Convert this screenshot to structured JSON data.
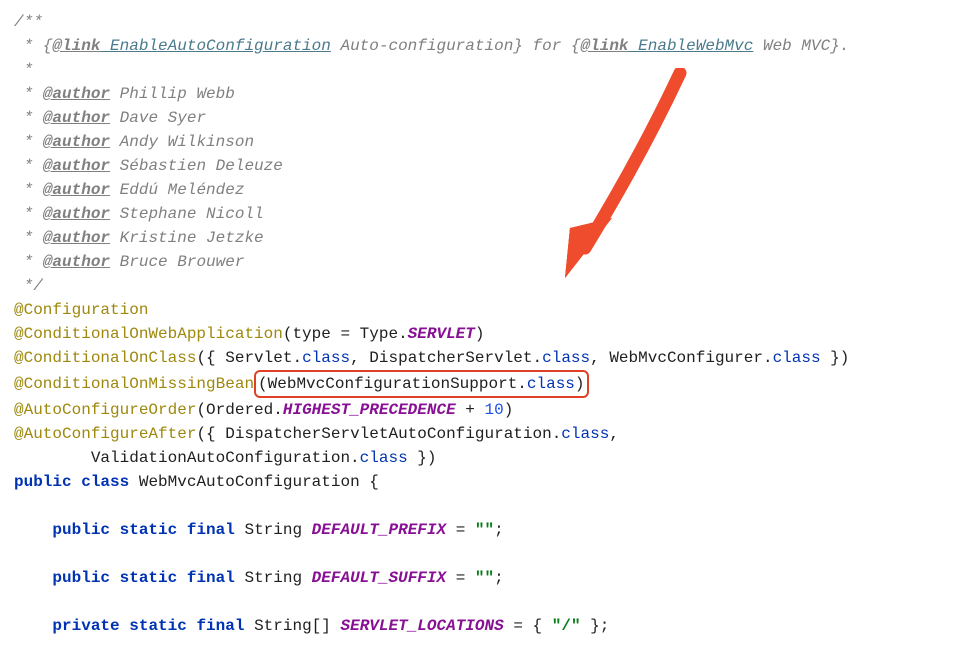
{
  "javadoc": {
    "open": "/**",
    "star": " *",
    "desc_prefix": " * {",
    "desc_link1_tag": "@link",
    "desc_link1_target": " EnableAutoConfiguration",
    "desc_link1_label": " Auto-configuration",
    "desc_mid": "} for {",
    "desc_link2_tag": "@link",
    "desc_link2_target": " EnableWebMvc",
    "desc_link2_label": " Web MVC",
    "desc_end": "}.",
    "author_tag": "@author",
    "authors": [
      " Phillip Webb",
      " Dave Syer",
      " Andy Wilkinson",
      " Sébastien Deleuze",
      " Eddú Meléndez",
      " Stephane Nicoll",
      " Kristine Jetzke",
      " Bruce Brouwer"
    ],
    "close": " */"
  },
  "annotations": {
    "a1": "@Configuration",
    "a2_name": "@ConditionalOnWebApplication",
    "a2_open": "(type = Type.",
    "a2_field": "SERVLET",
    "a2_close": ")",
    "a3_name": "@ConditionalOnClass",
    "a3_open": "({ Servlet.",
    "a3_k1": "class",
    "a3_c1": ", DispatcherServlet.",
    "a3_k2": "class",
    "a3_c2": ", WebMvcConfigurer.",
    "a3_k3": "class",
    "a3_end": " })",
    "a4_name": "@ConditionalOnMissingBean",
    "a4_boxed_open": "(WebMvcConfigurationSupport.",
    "a4_boxed_k": "class",
    "a4_boxed_close": ")",
    "a5_name": "@AutoConfigureOrder",
    "a5_open": "(Ordered.",
    "a5_field": "HIGHEST_PRECEDENCE",
    "a5_mid": " + ",
    "a5_num": "10",
    "a5_close": ")",
    "a6_name": "@AutoConfigureAfter",
    "a6_open": "({ DispatcherServletAutoConfiguration.",
    "a6_k1": "class",
    "a6_c1": ",",
    "a6_line2_indent": "        ValidationAutoConfiguration.",
    "a6_k2": "class",
    "a6_end": " })"
  },
  "classdecl": {
    "kw_public": "public",
    "kw_class": "class",
    "name": " WebMvcAutoConfiguration {"
  },
  "fields": {
    "indent": "    ",
    "kw_public": "public",
    "kw_private": "private",
    "kw_static": "static",
    "kw_final": "final",
    "type_string": " String ",
    "type_stringarr": " String[] ",
    "f1_name": "DEFAULT_PREFIX",
    "f1_eq": " = ",
    "f1_val": "\"\"",
    "semi": ";",
    "f2_name": "DEFAULT_SUFFIX",
    "f2_val": "\"\"",
    "f3_name": "SERVLET_LOCATIONS",
    "f3_eq": " = { ",
    "f3_val": "\"/\"",
    "f3_end": " };"
  },
  "arrow_color": "#ef4b2d"
}
